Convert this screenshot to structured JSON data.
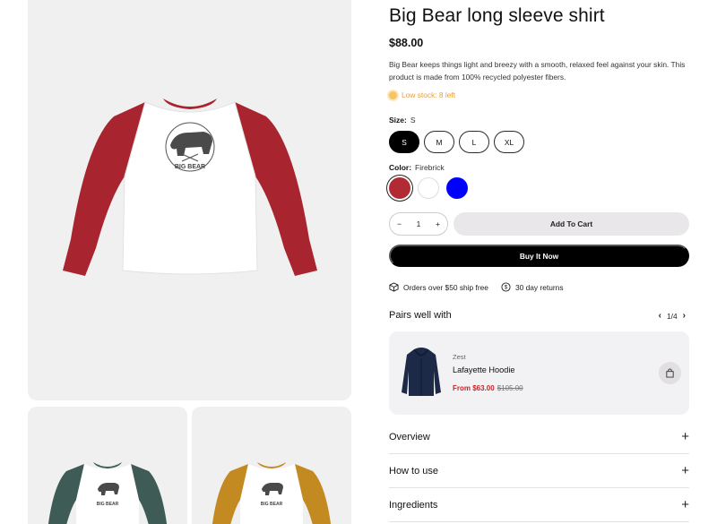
{
  "product": {
    "title": "Big Bear long sleeve shirt",
    "price": "$88.00",
    "description": "Big Bear keeps things light and breezy with a smooth, relaxed feel against your skin. This product is made from 100% recycled polyester fibers.",
    "stock": "Low stock: 8 left"
  },
  "size": {
    "label": "Size:",
    "selected": "S",
    "options": [
      "S",
      "M",
      "L",
      "XL"
    ]
  },
  "color": {
    "label": "Color:",
    "selected": "Firebrick",
    "swatches": [
      "#b22a34",
      "#ffffff",
      "#0000ff"
    ]
  },
  "quantity": {
    "value": "1",
    "minus": "−",
    "plus": "+"
  },
  "actions": {
    "add_to_cart": "Add To Cart",
    "buy_now": "Buy It Now"
  },
  "perks": {
    "shipping": "Orders over $50 ship free",
    "returns": "30 day returns"
  },
  "pairs": {
    "title": "Pairs well with",
    "pager": "1/4",
    "item": {
      "vendor": "Zest",
      "name": "Lafayette Hoodie",
      "sale_price": "From $63.00",
      "original_price": "$105.00"
    }
  },
  "accordion": [
    "Overview",
    "How to use",
    "Ingredients"
  ],
  "gallery": {
    "main_sleeve_color": "#a8252f",
    "thumb1_sleeve_color": "#3f5b55",
    "thumb2_sleeve_color": "#c48a22"
  }
}
